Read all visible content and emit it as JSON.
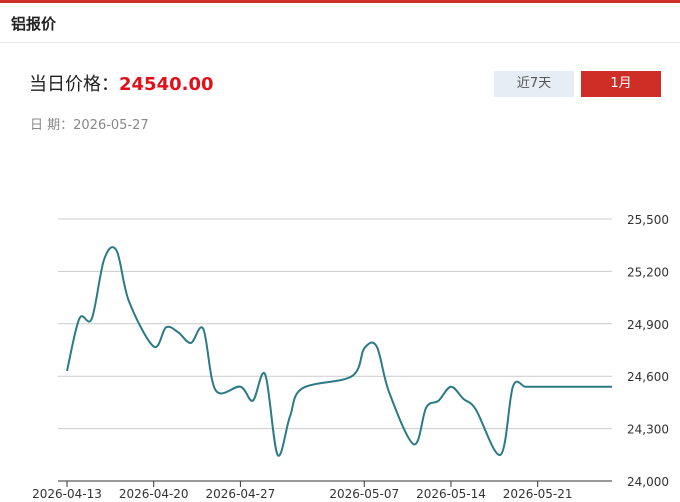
{
  "header": {
    "title": "铝报价"
  },
  "price": {
    "label": "当日价格：",
    "value": "24540.00"
  },
  "date": {
    "label": "日 期：",
    "value": "2026-05-27"
  },
  "tabs": [
    {
      "label": "近7天",
      "active": false
    },
    {
      "label": "1月",
      "active": true
    }
  ],
  "colors": {
    "accent": "#cf2e27",
    "line": "#2b7a86",
    "price": "#e0101a"
  },
  "chart_data": {
    "type": "line",
    "title": "",
    "xlabel": "",
    "ylabel": "",
    "ylim": [
      24000,
      25500
    ],
    "yticks": [
      24000,
      24300,
      24600,
      24900,
      25200,
      25500
    ],
    "ytick_labels": [
      "24,000",
      "24,300",
      "24,600",
      "24,900",
      "25,200",
      "25,500"
    ],
    "xticks": [
      "2026-04-13",
      "2026-04-20",
      "2026-04-27",
      "2026-05-07",
      "2026-05-14",
      "2026-05-21"
    ],
    "grid": true,
    "series": [
      {
        "x": [
          "2026-04-13",
          "2026-04-14",
          "2026-04-15",
          "2026-04-16",
          "2026-04-17",
          "2026-04-18",
          "2026-04-20",
          "2026-04-21",
          "2026-04-22",
          "2026-04-23",
          "2026-04-24",
          "2026-04-25",
          "2026-04-27",
          "2026-04-28",
          "2026-04-29",
          "2026-04-30",
          "2026-05-01",
          "2026-05-02",
          "2026-05-06",
          "2026-05-07",
          "2026-05-08",
          "2026-05-09",
          "2026-05-11",
          "2026-05-12",
          "2026-05-13",
          "2026-05-14",
          "2026-05-15",
          "2026-05-16",
          "2026-05-18",
          "2026-05-19",
          "2026-05-20",
          "2026-05-21",
          "2026-05-22",
          "2026-05-23",
          "2026-05-25",
          "2026-05-26",
          "2026-05-27"
        ],
        "values": [
          24630,
          24930,
          24930,
          25270,
          25320,
          25030,
          24770,
          24880,
          24850,
          24790,
          24870,
          24520,
          24540,
          24460,
          24610,
          24150,
          24370,
          24530,
          24600,
          24760,
          24770,
          24510,
          24210,
          24420,
          24460,
          24540,
          24470,
          24410,
          24150,
          24540,
          24540,
          24540,
          24540,
          24540,
          24540,
          24540,
          24540
        ]
      }
    ]
  }
}
